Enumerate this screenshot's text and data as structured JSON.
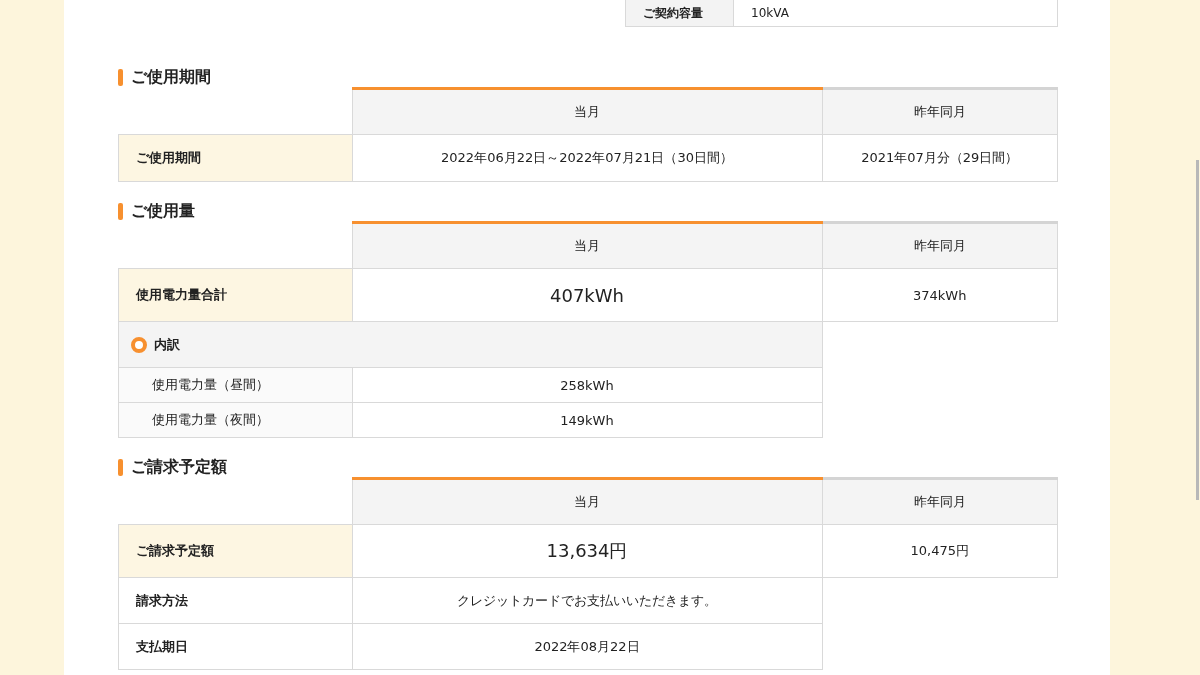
{
  "contract": {
    "label": "ご契約容量",
    "value": "10kVA"
  },
  "sections": [
    {
      "title": "ご使用期間",
      "columns": [
        "当月",
        "昨年同月"
      ],
      "rows": [
        {
          "kind": "period",
          "label": "ご使用期間",
          "values": [
            "2022年06月22日～2022年07月21日（30日間）",
            "2021年07月分（29日間）"
          ]
        }
      ]
    },
    {
      "title": "ご使用量",
      "columns": [
        "当月",
        "昨年同月"
      ],
      "rows": [
        {
          "kind": "total",
          "label": "使用電力量合計",
          "values": [
            "407kWh",
            "374kWh"
          ]
        },
        {
          "kind": "group",
          "label": "内訳",
          "values": []
        },
        {
          "kind": "sub",
          "label": "使用電力量（昼間）",
          "values": [
            "258kWh"
          ]
        },
        {
          "kind": "sub",
          "label": "使用電力量（夜間）",
          "values": [
            "149kWh"
          ]
        }
      ]
    },
    {
      "title": "ご請求予定額",
      "columns": [
        "当月",
        "昨年同月"
      ],
      "rows": [
        {
          "kind": "total",
          "label": "ご請求予定額",
          "values": [
            "13,634円",
            "10,475円"
          ]
        },
        {
          "kind": "info",
          "label": "請求方法",
          "values": [
            "クレジットカードでお支払いいただきます。"
          ]
        },
        {
          "kind": "info",
          "label": "支払期日",
          "values": [
            "2022年08月22日"
          ]
        }
      ]
    }
  ]
}
